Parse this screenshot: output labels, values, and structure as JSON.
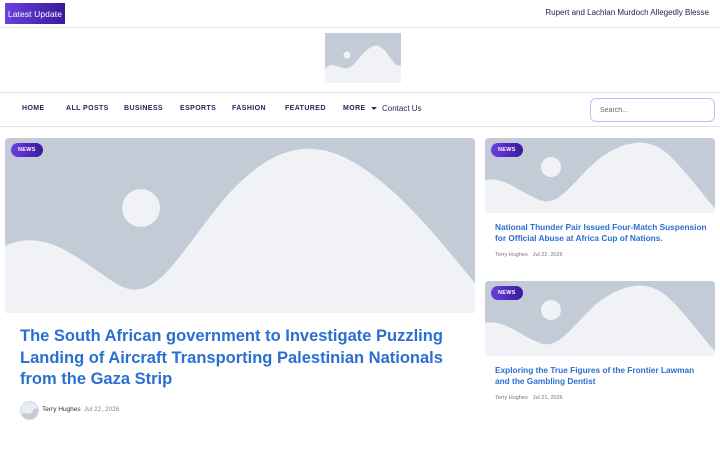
{
  "topbar": {
    "latest_label": "Latest  Update",
    "ticker_text": "Rupert and Lachlan Murdoch Allegedly Blesse"
  },
  "nav": {
    "items": [
      "HOME",
      "ALL POSTS",
      "BUSINESS",
      "ESPORTS",
      "FASHION",
      "FEATURED",
      "MORE",
      "Contact Us"
    ],
    "search_placeholder": "Search..."
  },
  "featured": {
    "badge": "NEWS",
    "title": "The South African government to Investigate Puzzling Landing of Aircraft Transporting Palestinian Nationals from the Gaza Strip",
    "author": "Terry Hughes",
    "date": "Jul 22, 2026"
  },
  "side_posts": [
    {
      "badge": "NEWS",
      "title": "National Thunder Pair Issued Four-Match Suspension for Official Abuse at Africa Cup of Nations.",
      "author": "Terry Hughes",
      "date": "Jul 22, 2026"
    },
    {
      "badge": "NEWS",
      "title": "Exploring the True Figures of the Frontier Lawman and the Gambling Dentist",
      "author": "Terry Hughes",
      "date": "Jul 21, 2026"
    }
  ],
  "colors": {
    "accent_gradient_start": "#6a3fe0",
    "accent_gradient_end": "#3a1a9a",
    "headline_blue": "#2a6fd1",
    "placeholder_gray": "#c3ccd6"
  }
}
